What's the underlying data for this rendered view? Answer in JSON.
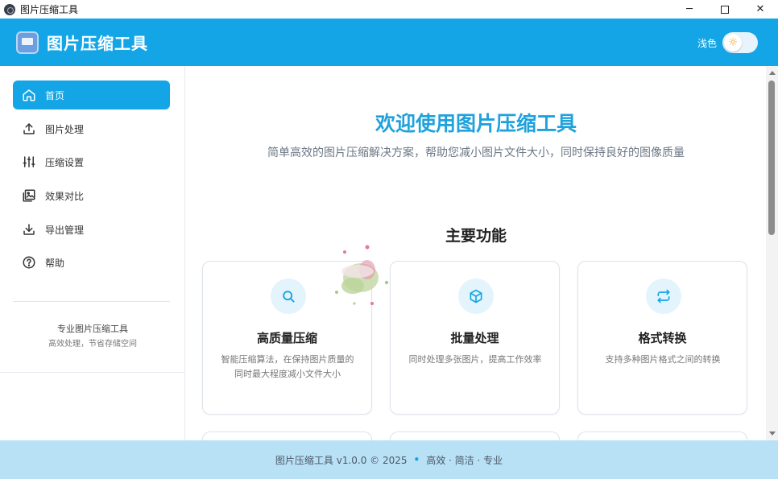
{
  "window": {
    "title": "图片压缩工具",
    "minimize": "─",
    "close": "✕"
  },
  "header": {
    "brand": "图片压缩工具",
    "theme_label": "浅色",
    "theme_icon": "sun-icon"
  },
  "sidebar": {
    "items": [
      {
        "label": "首页",
        "icon": "home-icon",
        "active": true
      },
      {
        "label": "图片处理",
        "icon": "upload-icon",
        "active": false
      },
      {
        "label": "压缩设置",
        "icon": "sliders-icon",
        "active": false
      },
      {
        "label": "效果对比",
        "icon": "image-compare-icon",
        "active": false
      },
      {
        "label": "导出管理",
        "icon": "download-icon",
        "active": false
      },
      {
        "label": "帮助",
        "icon": "help-icon",
        "active": false
      }
    ],
    "promo_title": "专业图片压缩工具",
    "promo_subtitle": "高效处理，节省存储空间"
  },
  "main": {
    "welcome": "欢迎使用图片压缩工具",
    "subtitle": "简单高效的图片压缩解决方案，帮助您减小图片文件大小，同时保持良好的图像质量",
    "section_title": "主要功能",
    "features": [
      {
        "title": "高质量压缩",
        "desc": "智能压缩算法，在保持图片质量的同时最大程度减小文件大小",
        "icon": "search-icon"
      },
      {
        "title": "批量处理",
        "desc": "同时处理多张图片，提高工作效率",
        "icon": "box-icon"
      },
      {
        "title": "格式转换",
        "desc": "支持多种图片格式之间的转换",
        "icon": "swap-icon"
      }
    ]
  },
  "footer": {
    "left": "图片压缩工具 v1.0.0 © 2025",
    "separator": "•",
    "right": "高效 · 简洁 · 专业"
  },
  "colors": {
    "primary": "#13a5e6",
    "footer_bg": "#b9e1f6",
    "welcome_text": "#1ea2dd"
  }
}
